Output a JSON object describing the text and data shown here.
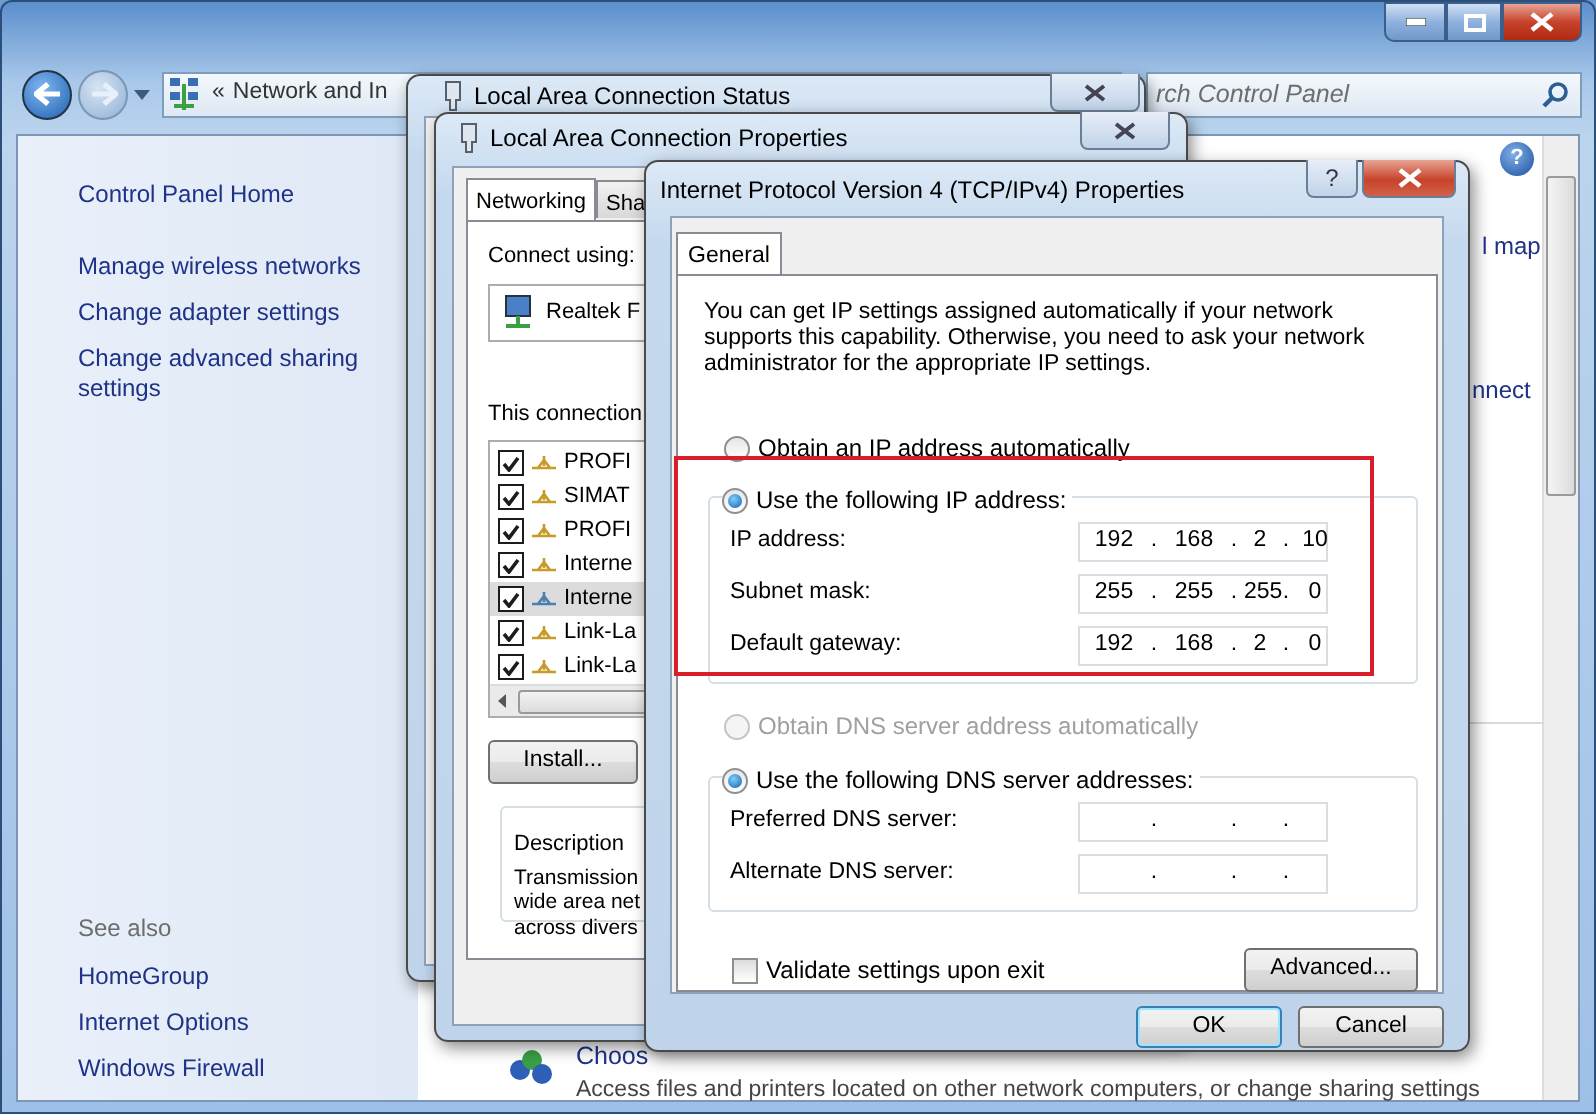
{
  "explorer": {
    "address": {
      "chevron": "«",
      "text": "Network and In"
    },
    "search": {
      "placeholder": "rch Control Panel"
    },
    "sidebar": {
      "items": [
        {
          "label": "Control Panel Home",
          "kind": "home"
        },
        {
          "label": "Manage wireless networks",
          "kind": "task"
        },
        {
          "label": "Change adapter settings",
          "kind": "task"
        },
        {
          "label": "Change advanced sharing settings",
          "kind": "task"
        }
      ],
      "see_also_title": "See also",
      "see_also": [
        "HomeGroup",
        "Internet Options",
        "Windows Firewall"
      ]
    },
    "content": {
      "help_glyph": "?",
      "links": [
        "l map",
        "nnect"
      ],
      "footer_link": "Choos",
      "footer_text": "Access files and printers located on other network computers, or change sharing settings"
    }
  },
  "status_window": {
    "title": "Local Area Connection Status"
  },
  "properties_window": {
    "title": "Local Area Connection Properties",
    "tabs": [
      {
        "label": "Networking",
        "selected": true
      },
      {
        "label": "Sha",
        "selected": false
      }
    ],
    "connect_using_label": "Connect using:",
    "adapter": "Realtek F",
    "components_label": "This connection",
    "components": [
      {
        "label": "PROFI",
        "checked": true,
        "selected": false,
        "color": "#c89a28"
      },
      {
        "label": "SIMAT",
        "checked": true,
        "selected": false,
        "color": "#c89a28"
      },
      {
        "label": "PROFI",
        "checked": true,
        "selected": false,
        "color": "#c89a28"
      },
      {
        "label": "Interne",
        "checked": true,
        "selected": false,
        "color": "#c89a28"
      },
      {
        "label": "Interne",
        "checked": true,
        "selected": true,
        "color": "#4f7fb0"
      },
      {
        "label": "Link-La",
        "checked": true,
        "selected": false,
        "color": "#c89a28"
      },
      {
        "label": "Link-La",
        "checked": true,
        "selected": false,
        "color": "#c89a28"
      }
    ],
    "install_button": "Install...",
    "description": {
      "title": "Description",
      "lines": [
        "Transmission",
        "wide area net",
        "across divers"
      ]
    }
  },
  "ipv4_window": {
    "title": "Internet Protocol Version 4 (TCP/IPv4) Properties",
    "help_glyph": "?",
    "tabs": [
      {
        "label": "General",
        "selected": true
      }
    ],
    "intro": "You can get IP settings assigned automatically if your network supports this capability. Otherwise, you need to ask your network administrator for the appropriate IP settings.",
    "ip_auto": {
      "label": "Obtain an IP address automatically",
      "selected": false
    },
    "ip_manual": {
      "label": "Use the following IP address:",
      "selected": true,
      "highlighted": true,
      "fields": [
        {
          "label": "IP address:",
          "octets": [
            "192",
            "168",
            "2",
            "10"
          ],
          "separators": [
            ".",
            ".",
            "."
          ]
        },
        {
          "label": "Subnet mask:",
          "octets": [
            "255",
            "255",
            "255",
            "0"
          ],
          "separators": [
            ".",
            ".",
            "."
          ]
        },
        {
          "label": "Default gateway:",
          "octets": [
            "192",
            "168",
            "2",
            "0"
          ],
          "separators": [
            ".",
            ".",
            "."
          ]
        }
      ]
    },
    "dns_auto": {
      "label": "Obtain DNS server address automatically",
      "selected": false,
      "disabled": true
    },
    "dns_manual": {
      "label": "Use the following DNS server addresses:",
      "selected": true,
      "fields": [
        {
          "label": "Preferred DNS server:",
          "separators": [
            ".",
            ".",
            "."
          ]
        },
        {
          "label": "Alternate DNS server:",
          "separators": [
            ".",
            ".",
            "."
          ]
        }
      ]
    },
    "validate": {
      "label": "Validate settings upon exit",
      "checked": false
    },
    "advanced_button": "Advanced...",
    "buttons": [
      {
        "label": "OK",
        "default": true
      },
      {
        "label": "Cancel",
        "default": false
      }
    ]
  }
}
